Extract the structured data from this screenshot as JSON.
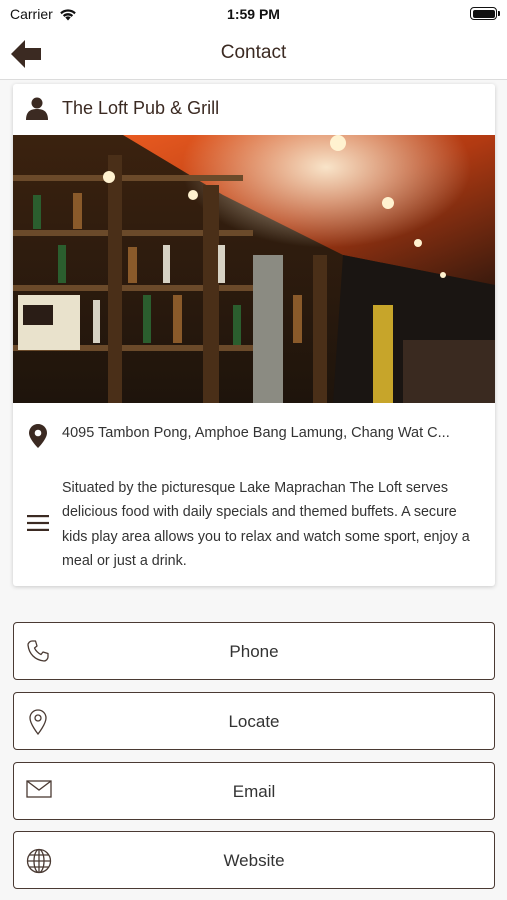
{
  "status_bar": {
    "carrier": "Carrier",
    "time": "1:59 PM"
  },
  "nav": {
    "title": "Contact",
    "back_icon": "arrow-left-icon"
  },
  "venue": {
    "name": "The Loft Pub & Grill",
    "photo_description_icon": "bar-photo",
    "address": "4095 Tambon Pong, Amphoe Bang Lamung, Chang Wat C...",
    "description": "Situated by the picturesque Lake Maprachan The Loft serves delicious food with daily specials and themed buffets. A secure kids play area allows you to relax and watch some sport, enjoy a meal or just a drink."
  },
  "actions": [
    {
      "label": "Phone",
      "icon": "phone-icon"
    },
    {
      "label": "Locate",
      "icon": "location-pin-icon"
    },
    {
      "label": "Email",
      "icon": "envelope-icon"
    },
    {
      "label": "Website",
      "icon": "globe-icon"
    }
  ],
  "colors": {
    "accent": "#3b2a22",
    "border": "#4a3a33",
    "background": "#f7f7f7"
  }
}
